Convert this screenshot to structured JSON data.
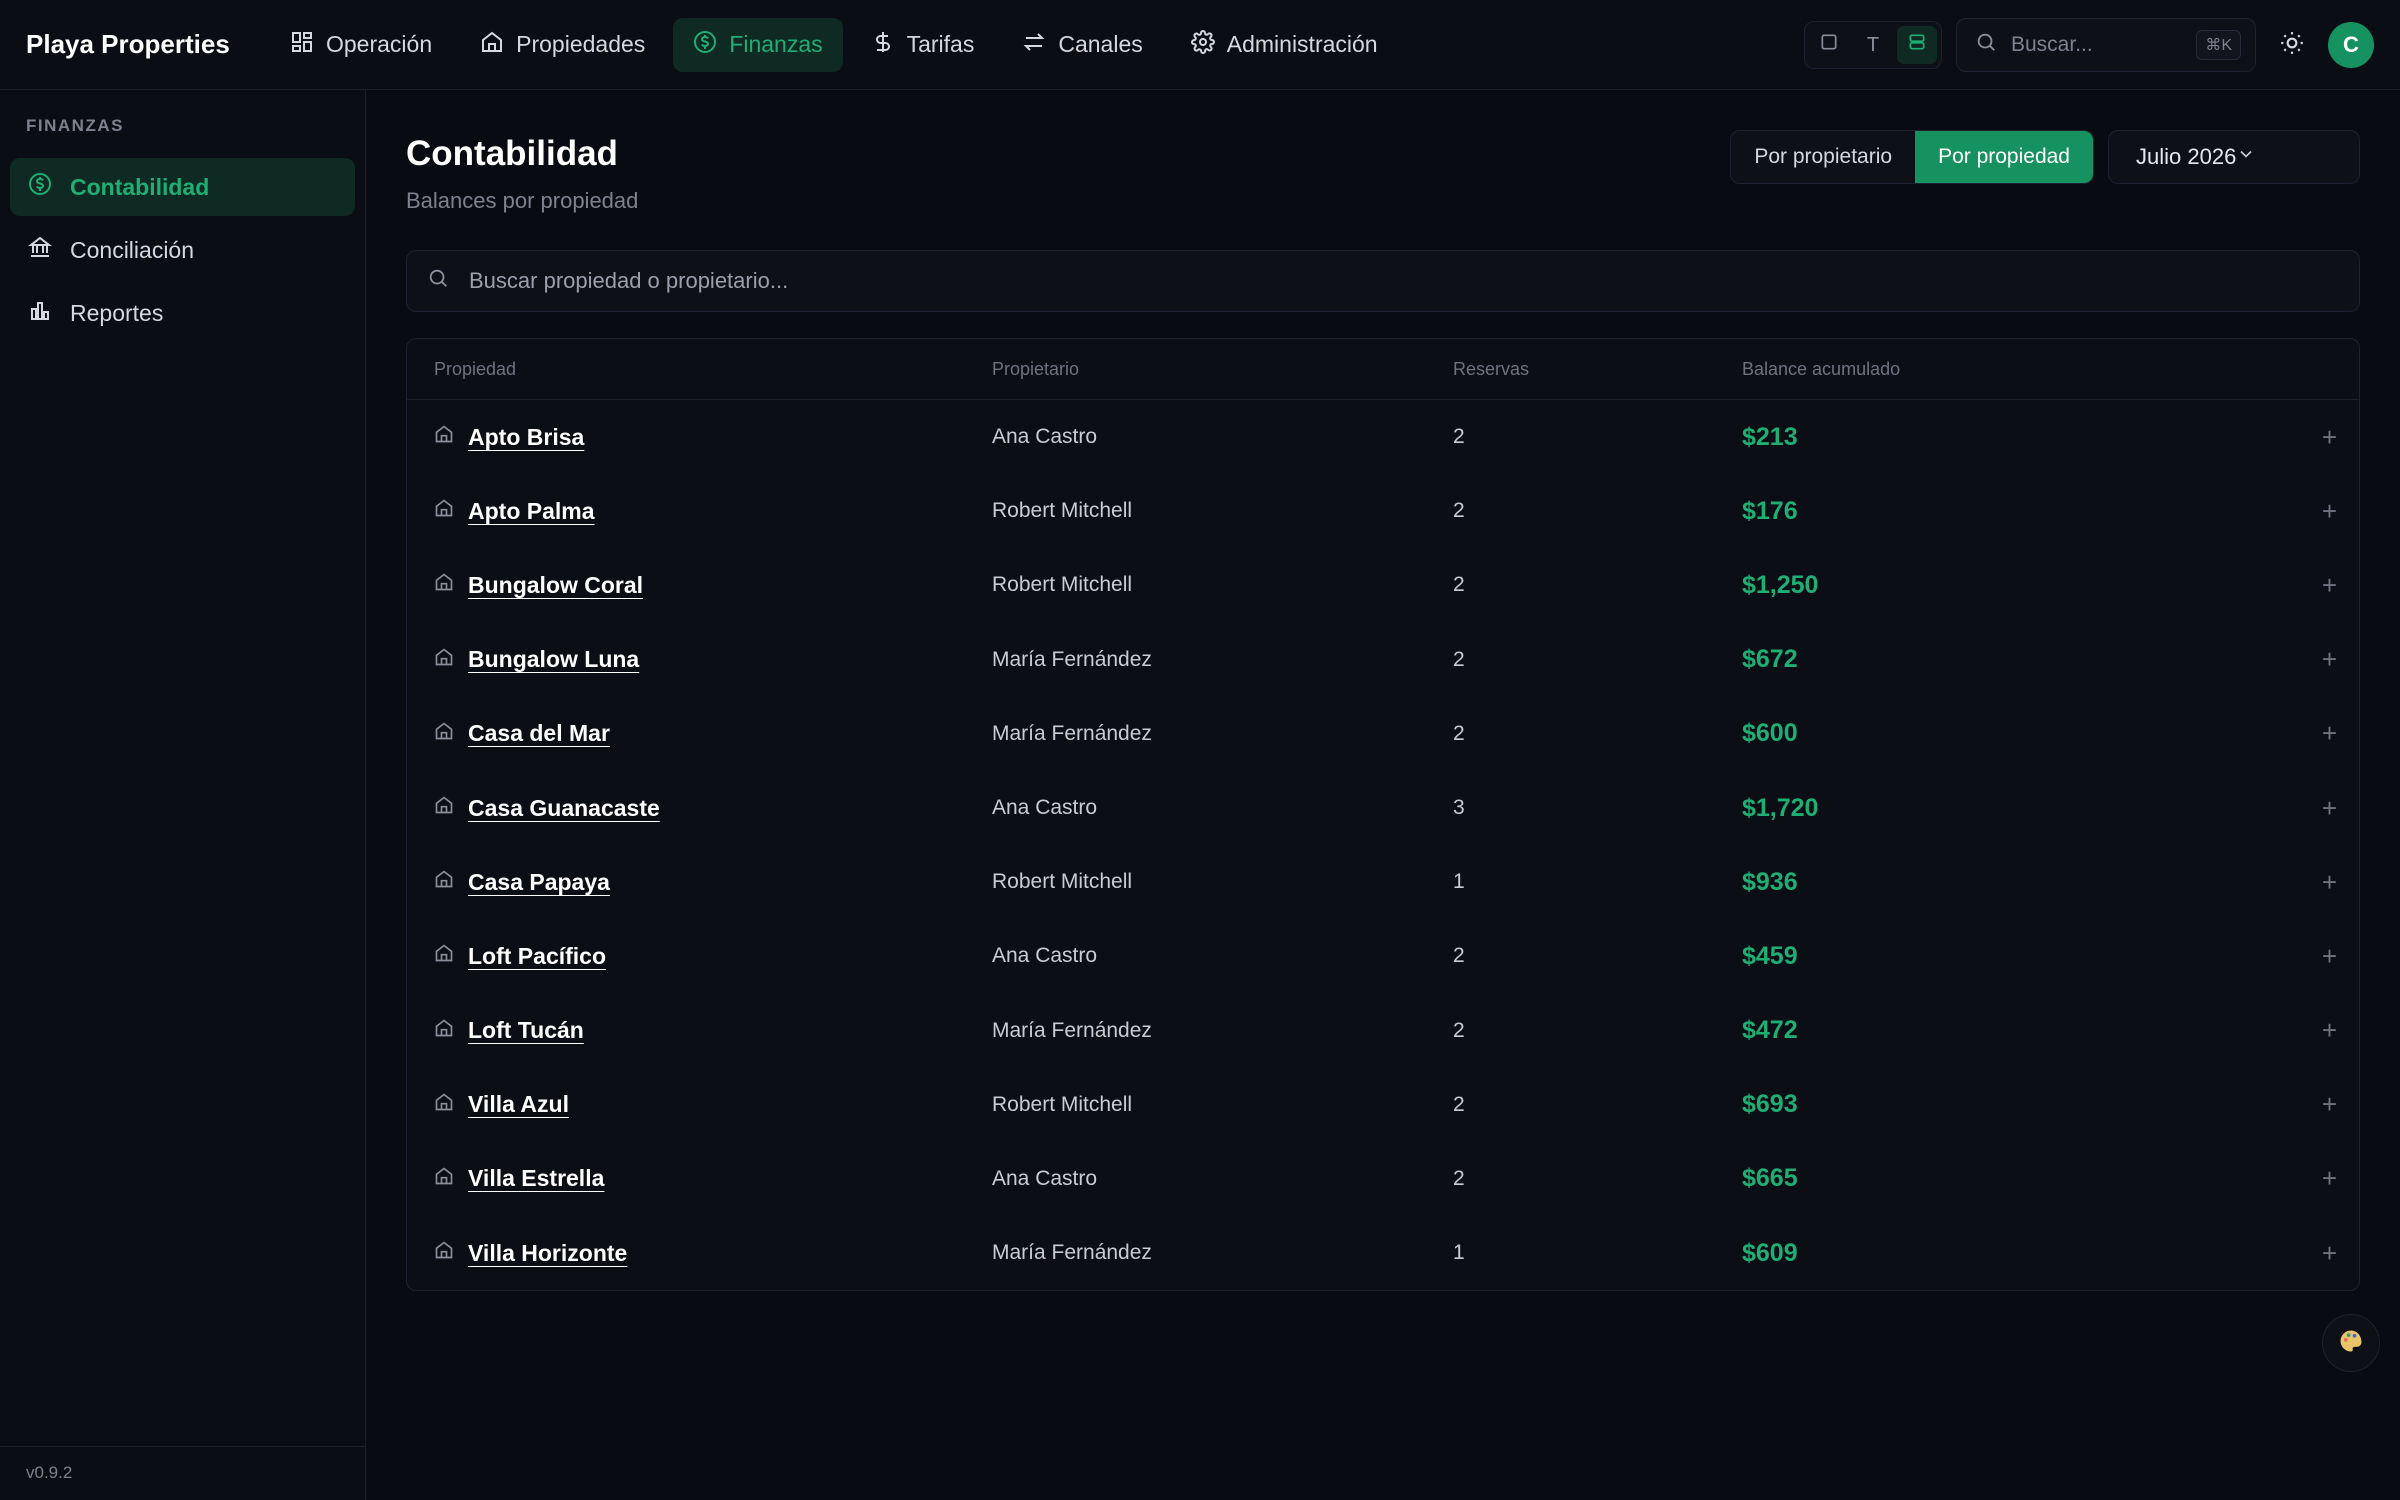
{
  "app": {
    "brand": "Playa Properties",
    "version": "v0.9.2"
  },
  "nav": [
    {
      "label": "Operación",
      "icon": "grid-icon"
    },
    {
      "label": "Propiedades",
      "icon": "home-icon"
    },
    {
      "label": "Finanzas",
      "icon": "dollar-circle-icon",
      "active": true
    },
    {
      "label": "Tarifas",
      "icon": "dollar-icon"
    },
    {
      "label": "Canales",
      "icon": "arrows-icon"
    },
    {
      "label": "Administración",
      "icon": "gear-icon"
    }
  ],
  "topbar": {
    "view_toggle": {
      "square": "",
      "text": "T",
      "list": ""
    },
    "search_placeholder": "Buscar...",
    "search_shortcut": "⌘K",
    "avatar_initial": "C"
  },
  "sidebar": {
    "section_title": "FINANZAS",
    "items": [
      {
        "label": "Contabilidad",
        "icon": "dollar-circle-icon",
        "active": true
      },
      {
        "label": "Conciliación",
        "icon": "bank-icon"
      },
      {
        "label": "Reportes",
        "icon": "bar-chart-icon"
      }
    ]
  },
  "page": {
    "title": "Contabilidad",
    "subtitle": "Balances por propiedad",
    "segment": {
      "by_owner": "Por propietario",
      "by_property": "Por propiedad",
      "active": "by_property"
    },
    "month": "Julio 2026",
    "search_placeholder": "Buscar propiedad o propietario..."
  },
  "table": {
    "headers": {
      "property": "Propiedad",
      "owner": "Propietario",
      "bookings": "Reservas",
      "balance": "Balance acumulado"
    },
    "rows": [
      {
        "property": "Apto Brisa",
        "owner": "Ana Castro",
        "bookings": "2",
        "balance": "$213"
      },
      {
        "property": "Apto Palma",
        "owner": "Robert Mitchell",
        "bookings": "2",
        "balance": "$176"
      },
      {
        "property": "Bungalow Coral",
        "owner": "Robert Mitchell",
        "bookings": "2",
        "balance": "$1,250"
      },
      {
        "property": "Bungalow Luna",
        "owner": "María Fernández",
        "bookings": "2",
        "balance": "$672"
      },
      {
        "property": "Casa del Mar",
        "owner": "María Fernández",
        "bookings": "2",
        "balance": "$600"
      },
      {
        "property": "Casa Guanacaste",
        "owner": "Ana Castro",
        "bookings": "3",
        "balance": "$1,720"
      },
      {
        "property": "Casa Papaya",
        "owner": "Robert Mitchell",
        "bookings": "1",
        "balance": "$936"
      },
      {
        "property": "Loft Pacífico",
        "owner": "Ana Castro",
        "bookings": "2",
        "balance": "$459"
      },
      {
        "property": "Loft Tucán",
        "owner": "María Fernández",
        "bookings": "2",
        "balance": "$472"
      },
      {
        "property": "Villa Azul",
        "owner": "Robert Mitchell",
        "bookings": "2",
        "balance": "$693"
      },
      {
        "property": "Villa Estrella",
        "owner": "Ana Castro",
        "bookings": "2",
        "balance": "$665"
      },
      {
        "property": "Villa Horizonte",
        "owner": "María Fernández",
        "bookings": "1",
        "balance": "$609"
      }
    ]
  },
  "colors": {
    "accent": "#15925f",
    "accent_text": "#1fae74",
    "background": "#090b12"
  }
}
